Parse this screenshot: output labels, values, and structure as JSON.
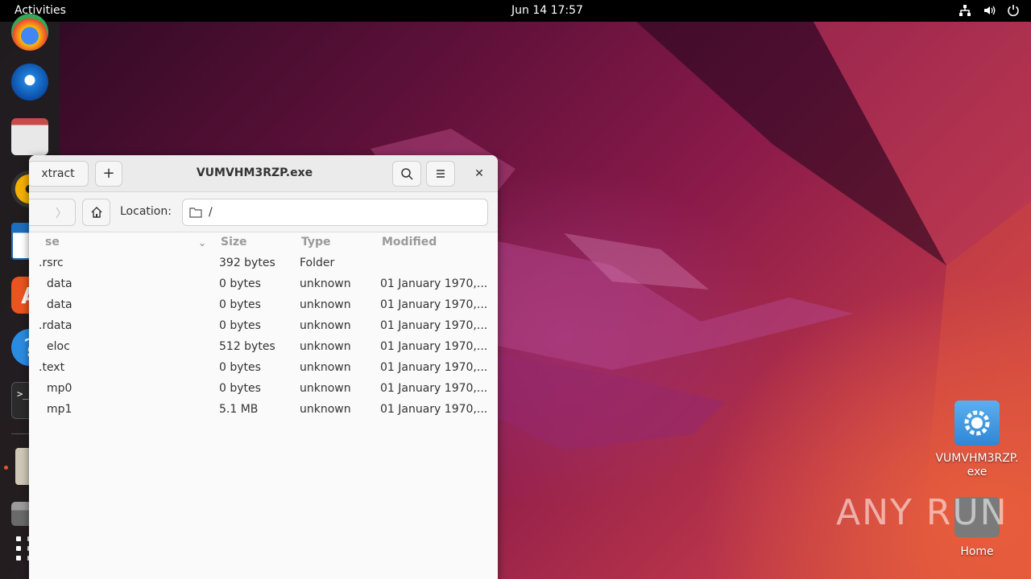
{
  "topbar": {
    "activities": "Activities",
    "clock": "Jun 14  17:57",
    "icons": [
      "network-icon",
      "volume-icon",
      "power-icon"
    ]
  },
  "dock": {
    "apps": [
      "chrome",
      "thunderbird",
      "files",
      "rhythmbox",
      "libreoffice-writer",
      "ubuntu-software",
      "help",
      "terminal",
      "archive-manager",
      "removable-drive",
      "show-apps"
    ]
  },
  "window": {
    "extract_label": "xtract",
    "title": "VUMVHM3RZP.exe",
    "location_label": "Location:",
    "location_value": "/",
    "columns": {
      "name": "se",
      "size": "Size",
      "type": "Type",
      "modified": "Modified"
    },
    "rows": [
      {
        "name": ".rsrc",
        "size": "392 bytes",
        "type": "Folder",
        "modified": ""
      },
      {
        "name": "data",
        "size": "0 bytes",
        "type": "unknown",
        "modified": "01 January 1970,..."
      },
      {
        "name": "data",
        "size": "0 bytes",
        "type": "unknown",
        "modified": "01 January 1970,..."
      },
      {
        "name": ".rdata",
        "size": "0 bytes",
        "type": "unknown",
        "modified": "01 January 1970,..."
      },
      {
        "name": "eloc",
        "size": "512 bytes",
        "type": "unknown",
        "modified": "01 January 1970,..."
      },
      {
        "name": ".text",
        "size": "0 bytes",
        "type": "unknown",
        "modified": "01 January 1970,..."
      },
      {
        "name": "mp0",
        "size": "0 bytes",
        "type": "unknown",
        "modified": "01 January 1970,..."
      },
      {
        "name": "mp1",
        "size": "5.1 MB",
        "type": "unknown",
        "modified": "01 January 1970,..."
      }
    ]
  },
  "desktop": {
    "exe_label": "VUMVHM3RZP.\nexe",
    "home_label": "Home",
    "watermark": "ANY RUN"
  },
  "colors": {
    "accent": "#e95420",
    "dock_bg": "#1e1e1e",
    "window_bg": "#fafafa"
  }
}
